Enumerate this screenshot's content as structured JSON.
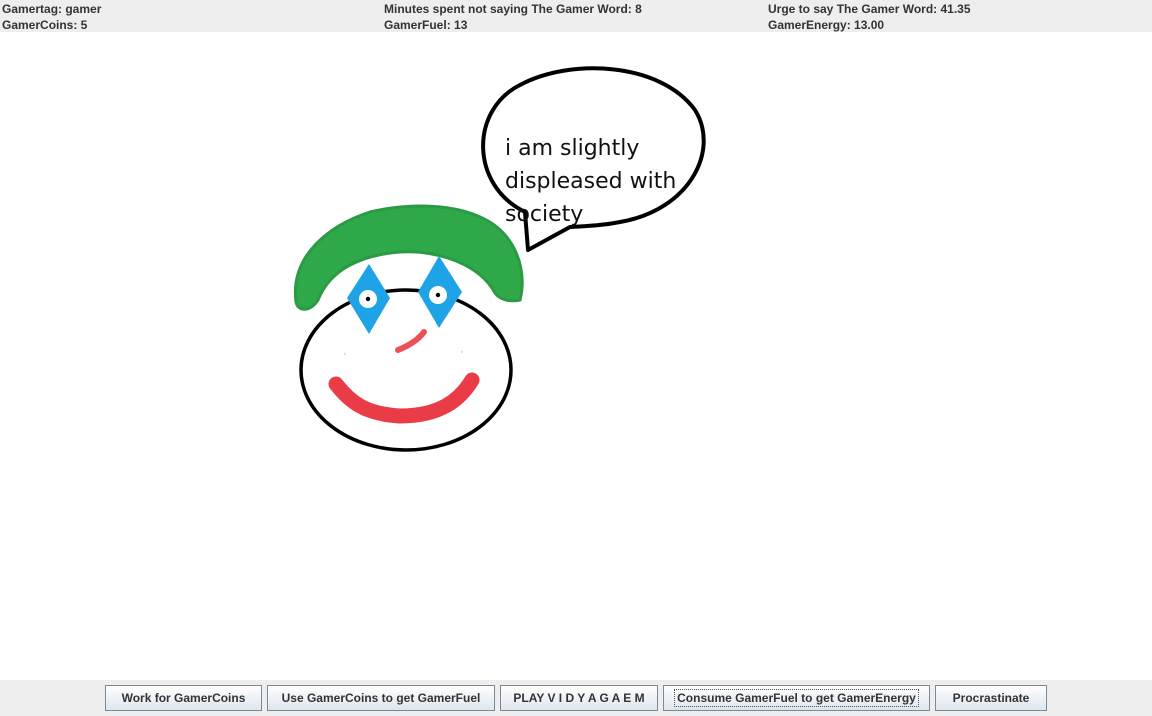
{
  "stats": {
    "gamertag": "Gamertag: gamer",
    "gamercoins": "GamerCoins: 5",
    "minutes": "Minutes spent not saying The Gamer Word: 8",
    "gamerfuel": "GamerFuel: 13",
    "urge": "Urge to say The Gamer Word: 41.35",
    "gamerenergy": "GamerEnergy: 13.00"
  },
  "speech": {
    "line1": "i am slightly",
    "line2": "displeased with",
    "line3": "society"
  },
  "buttons": {
    "work": "Work for GamerCoins",
    "buy_fuel": "Use GamerCoins to get GamerFuel",
    "play": "PLAY V I D Y A G A E M",
    "consume": "Consume GamerFuel to get GamerEnergy",
    "procrastinate": "Procrastinate"
  },
  "colors": {
    "hair": "#2fa84a",
    "eyes": "#1ea3e6",
    "mouth": "#e8323c",
    "background": "#ffffff",
    "bars": "#eeeeee"
  }
}
